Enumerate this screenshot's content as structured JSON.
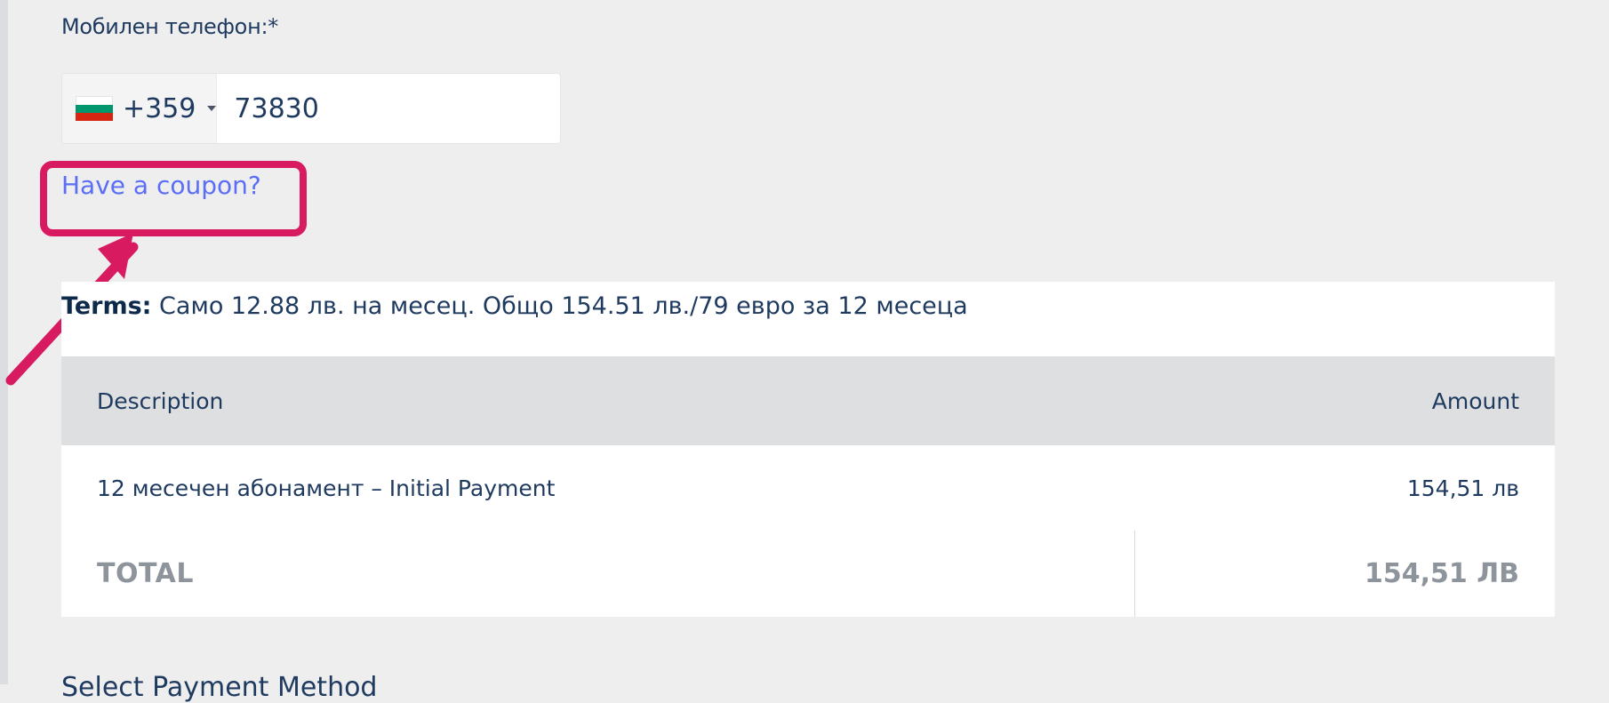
{
  "phone": {
    "label": "Мобилен телефон:*",
    "country_code": "+359",
    "flag_icon": "bulgaria-flag-icon",
    "value": "73830"
  },
  "coupon": {
    "link_text": "Have a coupon?"
  },
  "annotation": {
    "color": "#d81b60"
  },
  "terms": {
    "label": "Terms:",
    "text": " Само 12.88 лв. на месец. Общо 154.51 лв./79 евро за 12 месеца"
  },
  "order_table": {
    "headers": [
      "Description",
      "Amount"
    ],
    "rows": [
      {
        "description": "12 месечен абонамент – Initial Payment",
        "amount": "154,51 лв"
      }
    ],
    "total_label": "TOTAL",
    "total_value": "154,51 ЛВ"
  },
  "next_section": {
    "title": "Select Payment Method"
  },
  "colors": {
    "link": "#5b6ef5",
    "text": "#1f3a5f",
    "background": "#eeeeef"
  }
}
